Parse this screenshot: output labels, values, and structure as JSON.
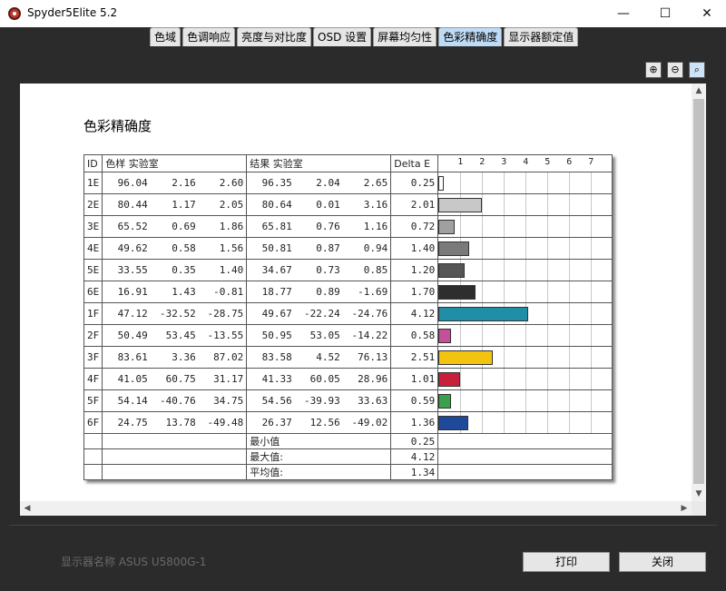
{
  "window": {
    "title": "Spyder5Elite 5.2",
    "min": "—",
    "max": "☐",
    "close": "✕"
  },
  "tabs": [
    "色域",
    "色调响应",
    "亮度与对比度",
    "OSD 设置",
    "屏幕均匀性",
    "色彩精确度",
    "显示器额定值"
  ],
  "active_tab": 5,
  "zoom": {
    "in": "⊕",
    "out": "⊖",
    "fit": "⌕"
  },
  "report": {
    "title": "色彩精确度",
    "headers": {
      "id": "ID",
      "sample": "色样 实验室",
      "result": "结果 实验室",
      "delta": "Delta E"
    },
    "axis_ticks": [
      "1",
      "2",
      "3",
      "4",
      "5",
      "6",
      "7"
    ],
    "rows": [
      {
        "id": "1E",
        "s": [
          "96.04",
          "2.16",
          "2.60"
        ],
        "r": [
          "96.35",
          "2.04",
          "2.65"
        ],
        "d": "0.25",
        "color": "#ffffff"
      },
      {
        "id": "2E",
        "s": [
          "80.44",
          "1.17",
          "2.05"
        ],
        "r": [
          "80.64",
          "0.01",
          "3.16"
        ],
        "d": "2.01",
        "color": "#c8c8c8"
      },
      {
        "id": "3E",
        "s": [
          "65.52",
          "0.69",
          "1.86"
        ],
        "r": [
          "65.81",
          "0.76",
          "1.16"
        ],
        "d": "0.72",
        "color": "#a0a0a0"
      },
      {
        "id": "4E",
        "s": [
          "49.62",
          "0.58",
          "1.56"
        ],
        "r": [
          "50.81",
          "0.87",
          "0.94"
        ],
        "d": "1.40",
        "color": "#7a7a7a"
      },
      {
        "id": "5E",
        "s": [
          "33.55",
          "0.35",
          "1.40"
        ],
        "r": [
          "34.67",
          "0.73",
          "0.85"
        ],
        "d": "1.20",
        "color": "#555555"
      },
      {
        "id": "6E",
        "s": [
          "16.91",
          "1.43",
          "-0.81"
        ],
        "r": [
          "18.77",
          "0.89",
          "-1.69"
        ],
        "d": "1.70",
        "color": "#2e2e2e"
      },
      {
        "id": "1F",
        "s": [
          "47.12",
          "-32.52",
          "-28.75"
        ],
        "r": [
          "49.67",
          "-22.24",
          "-24.76"
        ],
        "d": "4.12",
        "color": "#1f8ea6"
      },
      {
        "id": "2F",
        "s": [
          "50.49",
          "53.45",
          "-13.55"
        ],
        "r": [
          "50.95",
          "53.05",
          "-14.22"
        ],
        "d": "0.58",
        "color": "#c4509a"
      },
      {
        "id": "3F",
        "s": [
          "83.61",
          "3.36",
          "87.02"
        ],
        "r": [
          "83.58",
          "4.52",
          "76.13"
        ],
        "d": "2.51",
        "color": "#f2c40f"
      },
      {
        "id": "4F",
        "s": [
          "41.05",
          "60.75",
          "31.17"
        ],
        "r": [
          "41.33",
          "60.05",
          "28.96"
        ],
        "d": "1.01",
        "color": "#c8203c"
      },
      {
        "id": "5F",
        "s": [
          "54.14",
          "-40.76",
          "34.75"
        ],
        "r": [
          "54.56",
          "-39.93",
          "33.63"
        ],
        "d": "0.59",
        "color": "#3aa04a"
      },
      {
        "id": "6F",
        "s": [
          "24.75",
          "13.78",
          "-49.48"
        ],
        "r": [
          "26.37",
          "12.56",
          "-49.02"
        ],
        "d": "1.36",
        "color": "#1f4a9a"
      }
    ],
    "summary": [
      {
        "label": "最小值",
        "value": "0.25"
      },
      {
        "label": "最大值:",
        "value": "4.12"
      },
      {
        "label": "平均值:",
        "value": "1.34"
      }
    ]
  },
  "footer": {
    "monitor_label": "显示器名称 ASUS U5800G-1",
    "print": "打印",
    "close": "关闭"
  }
}
